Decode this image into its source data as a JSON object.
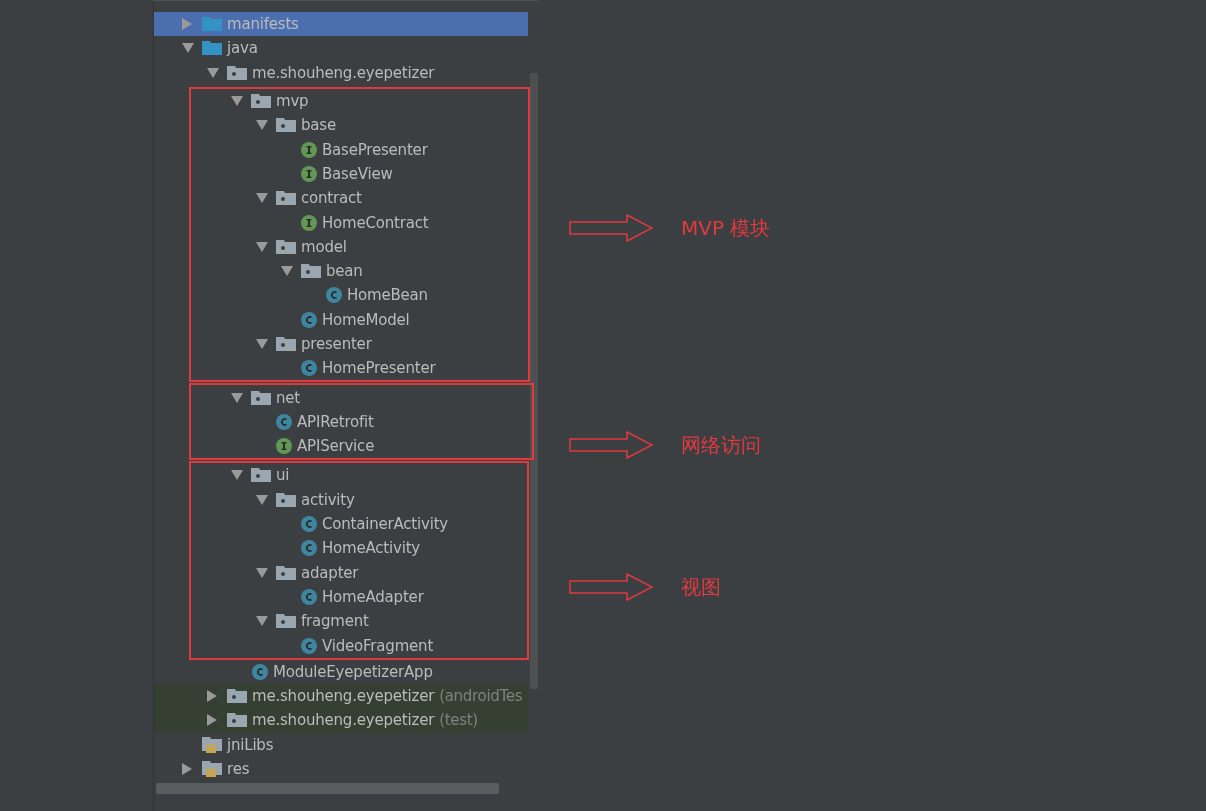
{
  "tree": [
    {
      "label": "manifests",
      "kind": "folder",
      "expanded": false,
      "selected": true
    },
    {
      "label": "java",
      "kind": "folder",
      "expanded": true,
      "selected": false,
      "children": [
        {
          "label": "me.shouheng.eyepetizer",
          "kind": "package",
          "expanded": true,
          "selected": false,
          "children": [
            {
              "label": "mvp",
              "kind": "package",
              "expanded": true,
              "selected": false,
              "children": [
                {
                  "label": "base",
                  "kind": "package",
                  "expanded": true,
                  "selected": false,
                  "children": [
                    {
                      "label": "BasePresenter",
                      "kind": "interface",
                      "selected": false
                    },
                    {
                      "label": "BaseView",
                      "kind": "interface",
                      "selected": false
                    }
                  ]
                },
                {
                  "label": "contract",
                  "kind": "package",
                  "expanded": true,
                  "selected": false,
                  "children": [
                    {
                      "label": "HomeContract",
                      "kind": "interface",
                      "selected": false
                    }
                  ]
                },
                {
                  "label": "model",
                  "kind": "package",
                  "expanded": true,
                  "selected": false,
                  "children": [
                    {
                      "label": "bean",
                      "kind": "package",
                      "expanded": true,
                      "selected": false,
                      "children": [
                        {
                          "label": "HomeBean",
                          "kind": "class",
                          "selected": false
                        }
                      ]
                    },
                    {
                      "label": "HomeModel",
                      "kind": "class",
                      "selected": false
                    }
                  ]
                },
                {
                  "label": "presenter",
                  "kind": "package",
                  "expanded": true,
                  "selected": false,
                  "children": [
                    {
                      "label": "HomePresenter",
                      "kind": "class",
                      "selected": false
                    }
                  ]
                }
              ]
            },
            {
              "label": "net",
              "kind": "package",
              "expanded": true,
              "selected": false,
              "children": [
                {
                  "label": "APIRetrofit",
                  "kind": "class",
                  "selected": false
                },
                {
                  "label": "APIService",
                  "kind": "interface",
                  "selected": false
                }
              ]
            },
            {
              "label": "ui",
              "kind": "package",
              "expanded": true,
              "selected": false,
              "children": [
                {
                  "label": "activity",
                  "kind": "package",
                  "expanded": true,
                  "selected": false,
                  "children": [
                    {
                      "label": "ContainerActivity",
                      "kind": "class",
                      "selected": false
                    },
                    {
                      "label": "HomeActivity",
                      "kind": "class",
                      "selected": false
                    }
                  ]
                },
                {
                  "label": "adapter",
                  "kind": "package",
                  "expanded": true,
                  "selected": false,
                  "children": [
                    {
                      "label": "HomeAdapter",
                      "kind": "class",
                      "selected": false
                    }
                  ]
                },
                {
                  "label": "fragment",
                  "kind": "package",
                  "expanded": true,
                  "selected": false,
                  "children": [
                    {
                      "label": "VideoFragment",
                      "kind": "class",
                      "selected": false
                    }
                  ]
                }
              ]
            },
            {
              "label": "ModuleEyepetizerApp",
              "kind": "class",
              "selected": false
            }
          ]
        },
        {
          "label": "me.shouheng.eyepetizer",
          "suffix": "(androidTes",
          "test": true,
          "kind": "package",
          "expanded": false,
          "selected": false
        },
        {
          "label": "me.shouheng.eyepetizer",
          "suffix": "(test)",
          "test": true,
          "kind": "package",
          "expanded": false,
          "selected": false
        }
      ]
    },
    {
      "label": "jniLibs",
      "kind": "libs",
      "selected": false
    },
    {
      "label": "res",
      "kind": "libs",
      "expanded": false,
      "selected": false
    }
  ],
  "annotations": [
    {
      "label": "MVP 模块"
    },
    {
      "label": "网络访问"
    },
    {
      "label": "视图"
    }
  ]
}
